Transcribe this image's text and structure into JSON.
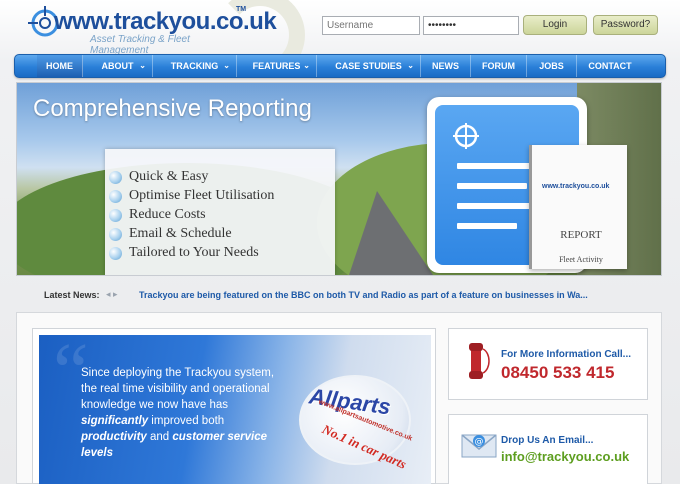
{
  "header": {
    "logo_text": "www.trackyou.co.uk",
    "logo_tm": "TM",
    "logo_tagline": "Asset Tracking & Fleet Management",
    "username_placeholder": "Username",
    "password_value": "••••••••",
    "login_label": "Login",
    "password_label": "Password?"
  },
  "nav": {
    "items": [
      {
        "label": "HOME",
        "dropdown": false
      },
      {
        "label": "ABOUT",
        "dropdown": true
      },
      {
        "label": "TRACKING",
        "dropdown": true
      },
      {
        "label": "FEATURES",
        "dropdown": true
      },
      {
        "label": "CASE STUDIES",
        "dropdown": true
      },
      {
        "label": "NEWS",
        "dropdown": false
      },
      {
        "label": "FORUM",
        "dropdown": false
      },
      {
        "label": "JOBS",
        "dropdown": false
      },
      {
        "label": "CONTACT",
        "dropdown": false
      }
    ],
    "active": "HOME",
    "chevron": "⌄"
  },
  "hero": {
    "title": "Comprehensive Reporting",
    "features": [
      "Quick & Easy",
      "Optimise Fleet Utilisation",
      "Reduce Costs",
      "Email & Schedule",
      "Tailored to Your Needs"
    ],
    "report_logo": "www.trackyou.co.uk",
    "report_title": "REPORT",
    "report_subtitle": "Fleet Activity"
  },
  "news": {
    "label": "Latest News:",
    "arrows": "◂ ▸",
    "text": "Trackyou are being featured on the BBC on both TV and Radio as part of a feature on businesses in Wa..."
  },
  "testimonial": {
    "line1": "Since deploying the Trackyou system, the real time visibility and operational knowledge we now have has ",
    "em1": "significantly",
    "line2": " improved both ",
    "em2": "productivity",
    "line3": " and ",
    "em3": "customer service levels",
    "brand": "Allparts",
    "brand_url": "www.allpartsautomotive.co.uk",
    "brand_slogan": "No.1 in car parts"
  },
  "contact": {
    "call_title": "For More Information Call...",
    "phone": "08450 533 415",
    "email_title": "Drop Us An Email...",
    "email": "info@trackyou.co.uk"
  },
  "colors": {
    "brand_blue": "#1e4f9c",
    "nav_blue": "#2a7fd8",
    "phone_red": "#c0282d",
    "email_green": "#5d9e1f"
  }
}
